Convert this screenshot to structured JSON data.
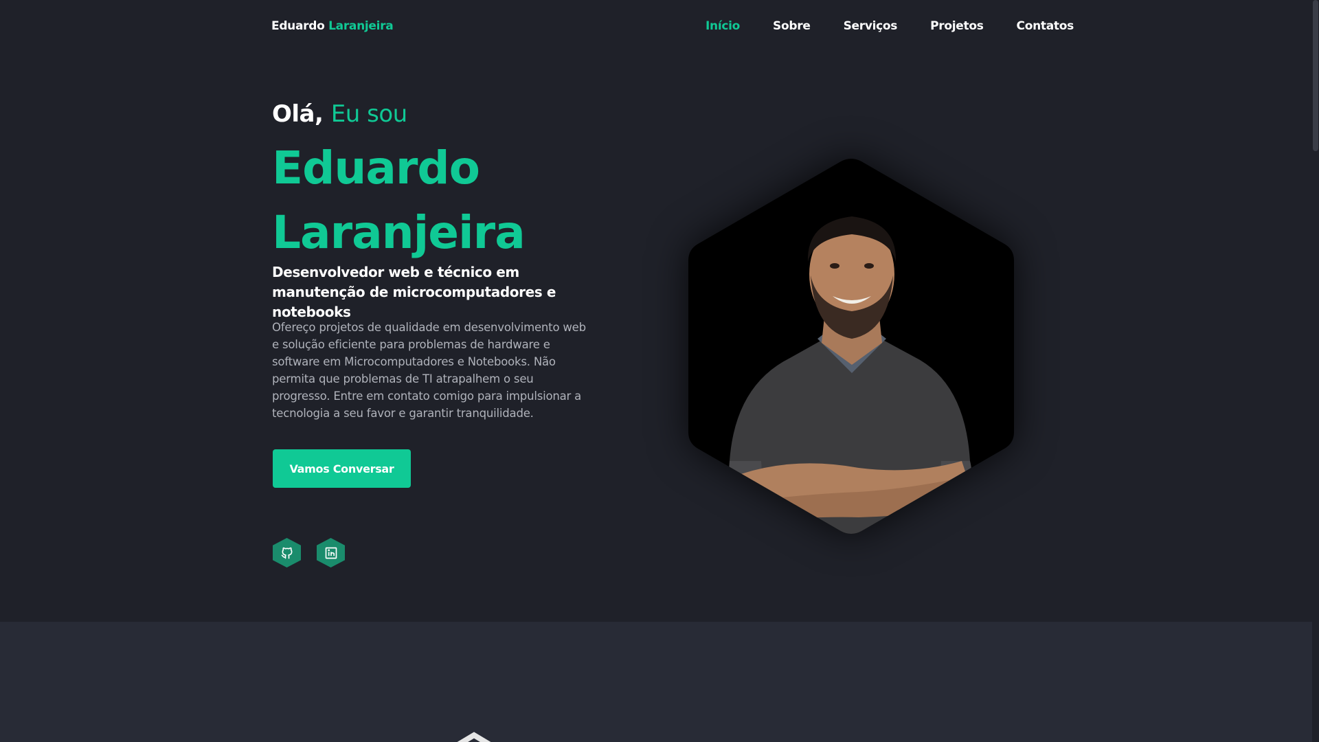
{
  "header": {
    "brand_first": "Eduardo",
    "brand_last": "Laranjeira",
    "nav": [
      {
        "label": "Início"
      },
      {
        "label": "Sobre"
      },
      {
        "label": "Serviços"
      },
      {
        "label": "Projetos"
      },
      {
        "label": "Contatos"
      }
    ],
    "active_nav": "Início"
  },
  "hero": {
    "greeting": "Olá,",
    "greeting_accent": "Eu sou",
    "name_line1": "Eduardo",
    "name_line2": "Laranjeira",
    "role": "Desenvolvedor web e técnico em manutenção de microcomputadores e notebooks",
    "description": "Ofereço projetos de qualidade em desenvolvimento web e solução eficiente para problemas de hardware e software em Microcomputadores e Notebooks. Não permita que problemas de TI atrapalhem o seu progresso. Entre em contato comigo para impulsionar a tecnologia a seu favor e garantir tranquilidade.",
    "cta_label": "Vamos Conversar",
    "socials": [
      {
        "icon": "github-icon"
      },
      {
        "icon": "linkedin-icon"
      }
    ]
  },
  "colors": {
    "accent": "#10c995",
    "background": "#1f2129",
    "section_alt": "#282b36",
    "social_bg": "#1a8c6c"
  }
}
